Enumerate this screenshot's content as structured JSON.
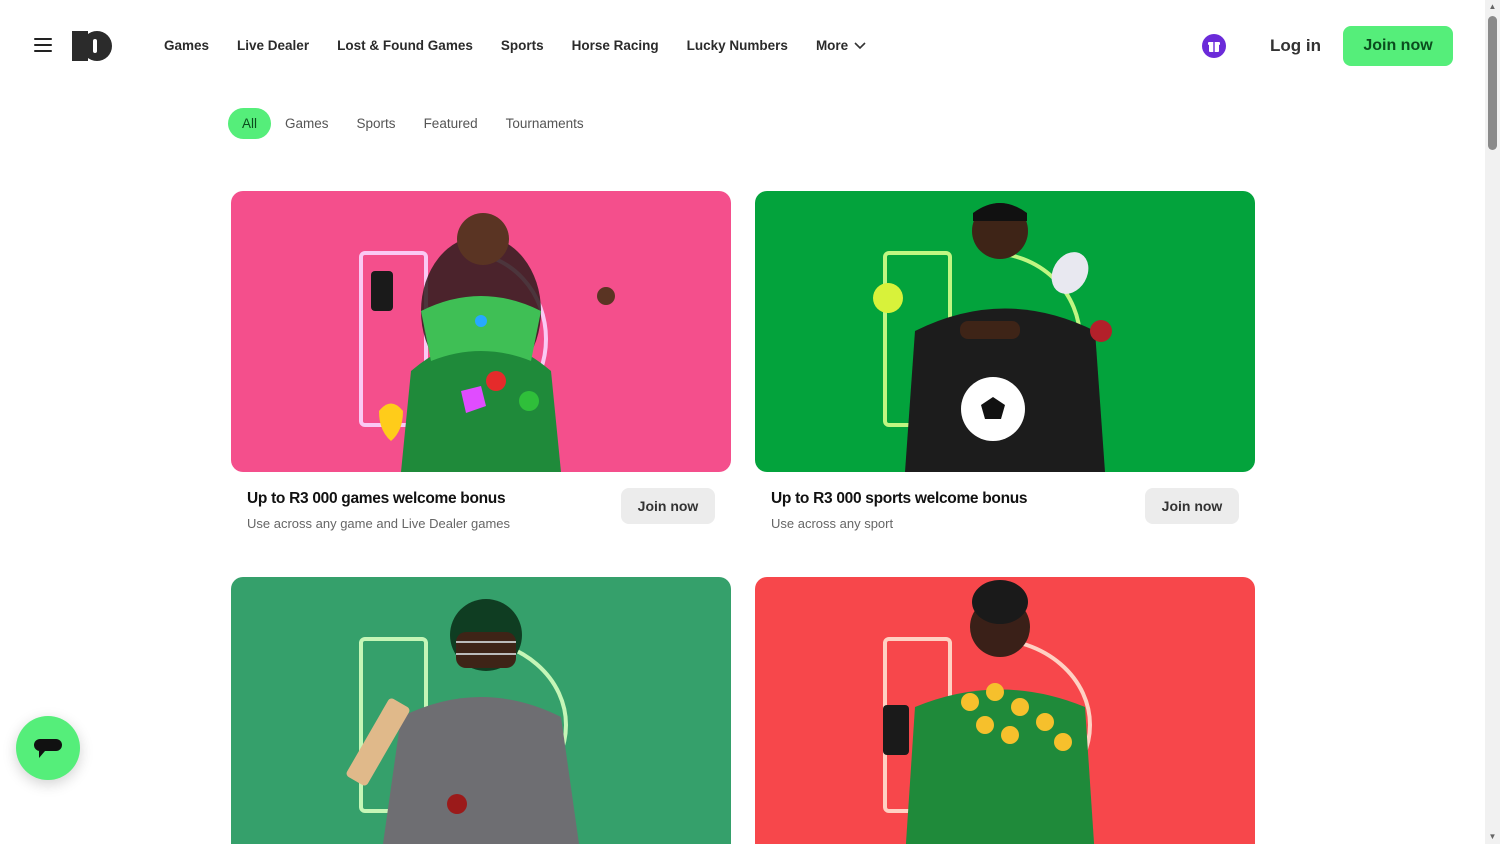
{
  "header": {
    "nav": [
      "Games",
      "Live Dealer",
      "Lost & Found Games",
      "Sports",
      "Horse Racing",
      "Lucky Numbers",
      "More"
    ],
    "login_label": "Log in",
    "join_label": "Join now"
  },
  "tabs": [
    "All",
    "Games",
    "Sports",
    "Featured",
    "Tournaments"
  ],
  "cards": [
    {
      "title": "Up to R3 000 games welcome bonus",
      "subtitle": "Use across any game and Live Dealer games",
      "button": "Join now",
      "bg": "#f44f8c"
    },
    {
      "title": "Up to R3 000 sports welcome bonus",
      "subtitle": "Use across any sport",
      "button": "Join now",
      "bg": "#03a33c"
    },
    {
      "bg": "#35a06b"
    },
    {
      "bg": "#f7474b"
    }
  ],
  "colors": {
    "accent": "#55ee7a",
    "gift": "#6b2bd9"
  },
  "icons": {
    "menu": "hamburger-icon",
    "gift": "gift-icon",
    "chat": "chat-icon",
    "chevron": "chevron-down-icon"
  }
}
